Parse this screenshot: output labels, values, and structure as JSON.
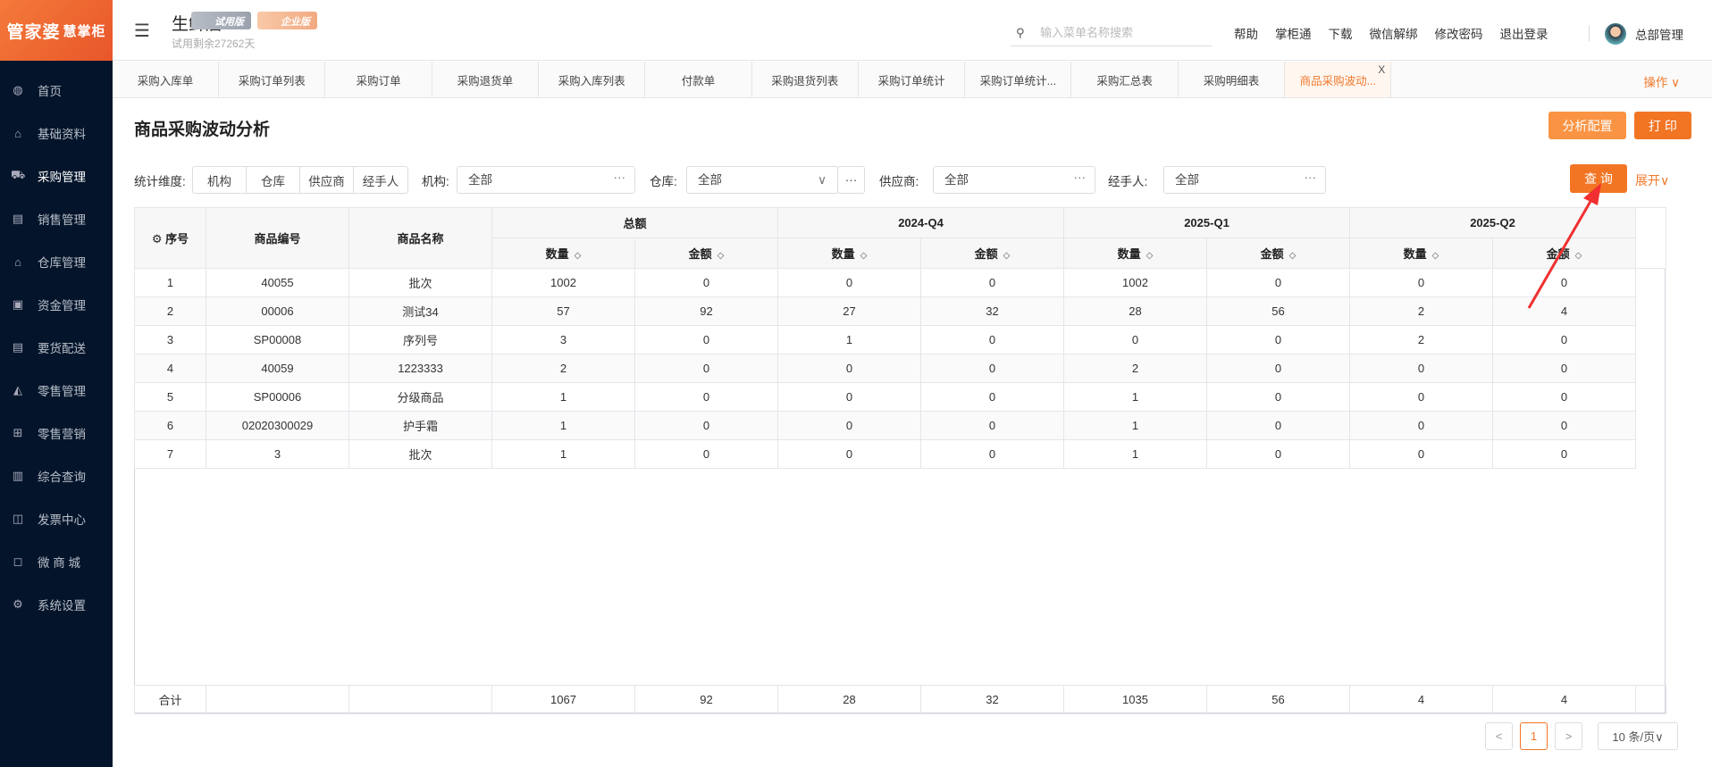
{
  "brand": {
    "logo_text": "管家婆",
    "logo_sub": "慧掌柜"
  },
  "sidebar": {
    "items": [
      {
        "label": "首页",
        "icon": "globe-icon"
      },
      {
        "label": "基础资料",
        "icon": "home-icon"
      },
      {
        "label": "采购管理",
        "icon": "cart-icon",
        "active": true
      },
      {
        "label": "销售管理",
        "icon": "calendar-check-icon"
      },
      {
        "label": "仓库管理",
        "icon": "bank-icon"
      },
      {
        "label": "资金管理",
        "icon": "yen-calendar-icon"
      },
      {
        "label": "要货配送",
        "icon": "list-box-icon"
      },
      {
        "label": "零售管理",
        "icon": "area-chart-icon"
      },
      {
        "label": "零售营销",
        "icon": "gift-icon"
      },
      {
        "label": "综合查询",
        "icon": "bar-chart-icon"
      },
      {
        "label": "发票中心",
        "icon": "line-chart-icon"
      },
      {
        "label": "微 商 城",
        "icon": "bag-icon"
      },
      {
        "label": "系统设置",
        "icon": "gear-icon"
      }
    ]
  },
  "header": {
    "store": "生鲜店",
    "badge_trial": "试用版",
    "badge_enterprise": "企业版",
    "trial_left": "试用剩余27262天",
    "search_placeholder": "输入菜单名称搜索",
    "links": [
      "帮助",
      "掌柜通",
      "下载",
      "微信解绑",
      "修改密码",
      "退出登录"
    ],
    "user": "总部管理"
  },
  "tabs": {
    "items": [
      "采购入库单",
      "采购订单列表",
      "采购订单",
      "采购退货单",
      "采购入库列表",
      "付款单",
      "采购退货列表",
      "采购订单统计",
      "采购订单统计...",
      "采购汇总表",
      "采购明细表",
      "商品采购波动..."
    ],
    "close": "X",
    "ops": "操作 ∨"
  },
  "page": {
    "title": "商品采购波动分析",
    "btn_config": "分析配置",
    "btn_print": "打 印",
    "btn_query": "查 询",
    "expand": "展开∨"
  },
  "filters": {
    "dimension_label": "统计维度:",
    "dimensions": [
      "机构",
      "仓库",
      "供应商",
      "经手人"
    ],
    "org_label": "机构:",
    "org_value": "全部",
    "wh_label": "仓库:",
    "wh_value": "全部",
    "sup_label": "供应商:",
    "sup_value": "全部",
    "handler_label": "经手人:",
    "handler_value": "全部",
    "dots": "···",
    "chev": "∨"
  },
  "table": {
    "groups": [
      "总额",
      "2024-Q4",
      "2025-Q1",
      "2025-Q2"
    ],
    "cols": {
      "seq": "序号",
      "code": "商品编号",
      "name": "商品名称",
      "qty": "数量",
      "amt": "金额"
    },
    "rows": [
      [
        "1",
        "40055",
        "批次",
        "1002",
        "0",
        "0",
        "0",
        "1002",
        "0",
        "0",
        "0"
      ],
      [
        "2",
        "00006",
        "测试34",
        "57",
        "92",
        "27",
        "32",
        "28",
        "56",
        "2",
        "4"
      ],
      [
        "3",
        "SP00008",
        "序列号",
        "3",
        "0",
        "1",
        "0",
        "0",
        "0",
        "2",
        "0"
      ],
      [
        "4",
        "40059",
        "1223333",
        "2",
        "0",
        "0",
        "0",
        "2",
        "0",
        "0",
        "0"
      ],
      [
        "5",
        "SP00006",
        "分级商品",
        "1",
        "0",
        "0",
        "0",
        "1",
        "0",
        "0",
        "0"
      ],
      [
        "6",
        "02020300029",
        "护手霜",
        "1",
        "0",
        "0",
        "0",
        "1",
        "0",
        "0",
        "0"
      ],
      [
        "7",
        "3",
        "批次",
        "1",
        "0",
        "0",
        "0",
        "1",
        "0",
        "0",
        "0"
      ]
    ],
    "total_label": "合计",
    "totals": [
      "1067",
      "92",
      "28",
      "32",
      "1035",
      "56",
      "4",
      "4"
    ]
  },
  "pagination": {
    "prev": "<",
    "page": "1",
    "next": ">",
    "size": "10 条/页∨"
  },
  "colors": {
    "accent": "#f07a2c",
    "sidebar": "#04152b",
    "arrow": "#f03030"
  }
}
